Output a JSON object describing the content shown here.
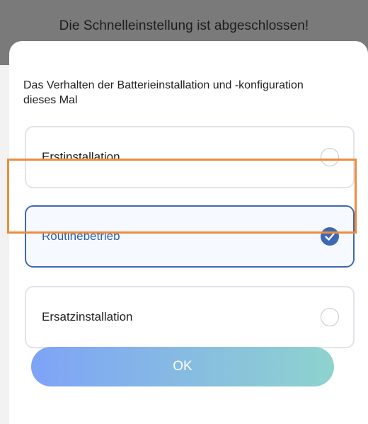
{
  "banner": {
    "message": "Die Schnelleinstellung ist abgeschlossen!"
  },
  "dialog": {
    "question": "Das Verhalten der Batterieinstallation und -konfiguration dieses Mal",
    "options": [
      {
        "label": "Erstinstallation",
        "selected": false
      },
      {
        "label": "Routinebetrieb",
        "selected": true
      },
      {
        "label": "Ersatzinstallation",
        "selected": false
      }
    ],
    "ok_label": "OK"
  },
  "colors": {
    "accent": "#3d68b5",
    "highlight": "#ec8c3c",
    "button_gradient_start": "#7ea3f7",
    "button_gradient_end": "#8ed3ce"
  },
  "icons": {
    "selected": "checkmark-circle-icon",
    "unselected": "empty-radio-icon"
  }
}
